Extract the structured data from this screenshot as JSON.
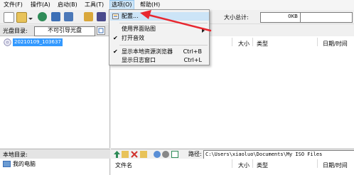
{
  "menubar": {
    "items": [
      "文件(F)",
      "操作(A)",
      "启动(B)",
      "工具(T)",
      "选项(O)",
      "帮助(H)"
    ]
  },
  "toolbar": {
    "size_label": "大小总计:",
    "size_value": "0KB"
  },
  "disc_pane": {
    "label": "光盘目录:",
    "boot_field": "不可引导光盘",
    "tree_item": "20210109_103637"
  },
  "disc_files": {
    "columns": [
      "大小",
      "类型",
      "日期/时间"
    ]
  },
  "local_pane": {
    "label": "本地目录:",
    "tree_item": "我的电脑"
  },
  "local_toolbar": {
    "path_label": "路径:",
    "path_value": "C:\\Users\\xiaoluo\\Documents\\My ISO Files"
  },
  "local_files": {
    "columns": [
      "文件名",
      "大小",
      "类型",
      "日期/时间"
    ]
  },
  "options_menu": {
    "items": [
      {
        "label": "配置...",
        "shortcut": "",
        "checked": false,
        "highlighted": true
      },
      {
        "label": "使用界面贴图",
        "shortcut": "",
        "checked": false,
        "highlighted": false
      },
      {
        "label": "打开音效",
        "shortcut": "",
        "checked": true,
        "highlighted": false
      },
      {
        "label": "显示本地资源浏览器",
        "shortcut": "Ctrl+B",
        "checked": true,
        "highlighted": false
      },
      {
        "label": "显示日志窗口",
        "shortcut": "Ctrl+L",
        "checked": false,
        "highlighted": false
      }
    ]
  },
  "colors": {
    "arrow": "#e8272f",
    "selection": "#3399ff",
    "menu_highlight": "#cce4f7"
  }
}
